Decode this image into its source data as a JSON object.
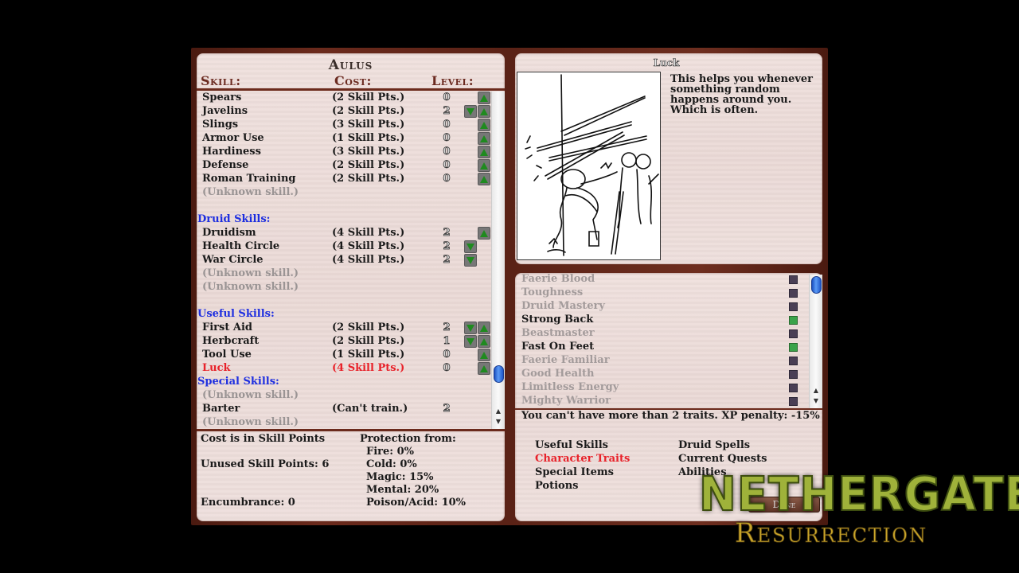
{
  "character": {
    "name": "Aulus"
  },
  "skills_header": {
    "skill": "Skill:",
    "cost": "Cost:",
    "level": "Level:"
  },
  "skills": [
    {
      "type": "skill",
      "name": "Spears",
      "cost": "(2 Skill Pts.)",
      "level": "0",
      "can_decrease": false,
      "can_increase": true
    },
    {
      "type": "skill",
      "name": "Javelins",
      "cost": "(2 Skill Pts.)",
      "level": "2",
      "can_decrease": true,
      "can_increase": true
    },
    {
      "type": "skill",
      "name": "Slings",
      "cost": "(3 Skill Pts.)",
      "level": "0",
      "can_decrease": false,
      "can_increase": true
    },
    {
      "type": "skill",
      "name": "Armor Use",
      "cost": "(1 Skill Pts.)",
      "level": "0",
      "can_decrease": false,
      "can_increase": true
    },
    {
      "type": "skill",
      "name": "Hardiness",
      "cost": "(3 Skill Pts.)",
      "level": "0",
      "can_decrease": false,
      "can_increase": true
    },
    {
      "type": "skill",
      "name": "Defense",
      "cost": "(2 Skill Pts.)",
      "level": "0",
      "can_decrease": false,
      "can_increase": true
    },
    {
      "type": "skill",
      "name": "Roman Training",
      "cost": "(2 Skill Pts.)",
      "level": "0",
      "can_decrease": false,
      "can_increase": true
    },
    {
      "type": "unknown",
      "name": "(Unknown skill.)"
    },
    {
      "type": "blank"
    },
    {
      "type": "category",
      "name": "Druid Skills:"
    },
    {
      "type": "skill",
      "name": "Druidism",
      "cost": "(4 Skill Pts.)",
      "level": "2",
      "can_decrease": false,
      "can_increase": true
    },
    {
      "type": "skill",
      "name": "Health Circle",
      "cost": "(4 Skill Pts.)",
      "level": "2",
      "can_decrease": true,
      "can_increase": false
    },
    {
      "type": "skill",
      "name": "War Circle",
      "cost": "(4 Skill Pts.)",
      "level": "2",
      "can_decrease": true,
      "can_increase": false
    },
    {
      "type": "unknown",
      "name": "(Unknown skill.)"
    },
    {
      "type": "unknown",
      "name": "(Unknown skill.)"
    },
    {
      "type": "blank"
    },
    {
      "type": "category",
      "name": "Useful Skills:"
    },
    {
      "type": "skill",
      "name": "First Aid",
      "cost": "(2 Skill Pts.)",
      "level": "2",
      "can_decrease": true,
      "can_increase": true
    },
    {
      "type": "skill",
      "name": "Herbcraft",
      "cost": "(2 Skill Pts.)",
      "level": "1",
      "can_decrease": true,
      "can_increase": true
    },
    {
      "type": "skill",
      "name": "Tool Use",
      "cost": "(1 Skill Pts.)",
      "level": "0",
      "can_decrease": false,
      "can_increase": true
    },
    {
      "type": "skill",
      "name": "Luck",
      "cost": "(4 Skill Pts.)",
      "level": "0",
      "can_decrease": false,
      "can_increase": true,
      "selected": true
    },
    {
      "type": "category",
      "name": "Special Skills:"
    },
    {
      "type": "unknown",
      "name": "(Unknown skill.)"
    },
    {
      "type": "skill",
      "name": "Barter",
      "cost": "(Can't train.)",
      "level": "2",
      "can_decrease": false,
      "can_increase": false
    },
    {
      "type": "unknown",
      "name": "(Unknown skill.)"
    }
  ],
  "skills_scroll": {
    "position": 0.92
  },
  "stats": {
    "cost_note": "Cost is in Skill Points",
    "unused_points": "Unused Skill Points: 6",
    "encumbrance": "Encumbrance: 0",
    "protection_title": "Protection from:",
    "protection": [
      "Fire: 0%",
      "Cold: 0%",
      "Magic: 15%",
      "Mental: 20%",
      "Poison/Acid: 10%"
    ]
  },
  "description": {
    "title": "Luck",
    "text": "This helps you whenever something random happens around you. Which is often.",
    "illustration": "roman-soldier-dodging-spears"
  },
  "traits": [
    {
      "name": "Faerie Blood",
      "selected": false
    },
    {
      "name": "Toughness",
      "selected": false
    },
    {
      "name": "Druid Mastery",
      "selected": false
    },
    {
      "name": "Strong Back",
      "selected": true
    },
    {
      "name": "Beastmaster",
      "selected": false
    },
    {
      "name": "Fast On Feet",
      "selected": true
    },
    {
      "name": "Faerie Familiar",
      "selected": false
    },
    {
      "name": "Good Health",
      "selected": false
    },
    {
      "name": "Limitless Energy",
      "selected": false
    },
    {
      "name": "Mighty Warrior",
      "selected": false
    }
  ],
  "traits_scroll": {
    "position": 0.0
  },
  "trait_penalty": "You can't have more than 2 traits. XP penalty: -15%",
  "menu": {
    "left": [
      {
        "label": "Useful Skills",
        "active": false
      },
      {
        "label": "Character Traits",
        "active": true
      },
      {
        "label": "Special Items",
        "active": false
      },
      {
        "label": "Potions",
        "active": false
      }
    ],
    "right": [
      {
        "label": "Druid Spells",
        "active": false
      },
      {
        "label": "Current Quests",
        "active": false
      },
      {
        "label": "Abilities",
        "active": false
      }
    ]
  },
  "done_button": "Done",
  "logo": {
    "title": "NETHERGATE",
    "subtitle": "Resurrection"
  },
  "colors": {
    "selected": "#e8222a",
    "category": "#1e2fe0",
    "frame": "#6b2a1c",
    "parchment": "#ecdcd9",
    "trait_on": "#3aa34a",
    "trait_off": "#4a3f55",
    "logo_green": "#9fb23a",
    "logo_gold": "#c9a52a"
  }
}
